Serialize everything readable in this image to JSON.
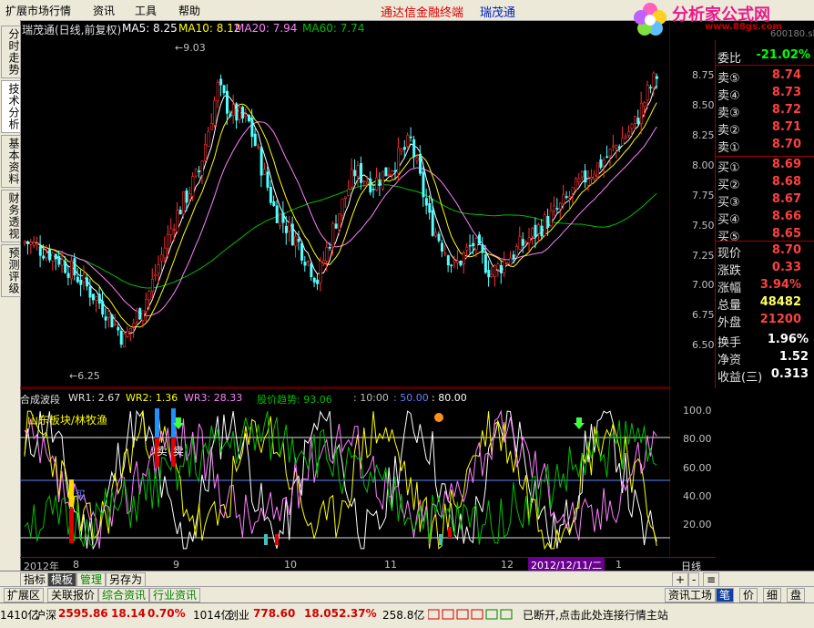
{
  "menu": {
    "items": [
      "扩展市场行情",
      "资讯",
      "工具",
      "帮助"
    ],
    "brand_red": "通达信金融终端",
    "brand_blue": "瑞茂通",
    "logo_title": "分析家公式网",
    "logo_url": "www.88gs.com",
    "logo_code": "600180.sh"
  },
  "left_tabs": [
    "分时走势",
    "技术分析",
    "基本资料",
    "财务透视",
    "预测评级"
  ],
  "main_header": {
    "title": "瑞茂通(日线,前复权)",
    "ma5": "MA5: 8.25",
    "ma10": "MA10: 8.12",
    "ma20": "MA20: 7.94",
    "ma60": "MA60: 7.74",
    "high_label": "9.03",
    "low_label": "6.25"
  },
  "price_axis": [
    "8.75",
    "8.50",
    "8.25",
    "8.00",
    "7.75",
    "7.50",
    "7.25",
    "7.00",
    "6.75",
    "6.50"
  ],
  "sub_header": {
    "name": "合成波段",
    "wr1": "WR1: 2.67",
    "wr2": "WR2: 1.36",
    "wr3": "WR3: 28.33",
    "trend": "股价趋势: 93.06",
    "v1": ": 10:00",
    "v2": ": 50.00",
    "v3": ": 80.00",
    "overlay": "山东板块/林牧渔",
    "buy_label": "买",
    "sell_label1": "卖",
    "sell_label2": "卖"
  },
  "sub_axis": [
    "100.0",
    "80.00",
    "60.00",
    "40.00",
    "20.00"
  ],
  "date_axis": {
    "year": "2012年",
    "months": [
      "8",
      "9",
      "10",
      "11",
      "12",
      "1"
    ],
    "cursor_date": "2012/12/11/二",
    "period": "日线"
  },
  "quote": {
    "ratio_label": "委比",
    "ratio_value": "-21.02%",
    "sells": [
      {
        "label": "卖⑤",
        "price": "8.74"
      },
      {
        "label": "卖④",
        "price": "8.73"
      },
      {
        "label": "卖③",
        "price": "8.72"
      },
      {
        "label": "卖②",
        "price": "8.71"
      },
      {
        "label": "卖①",
        "price": "8.70"
      }
    ],
    "buys": [
      {
        "label": "买①",
        "price": "8.69"
      },
      {
        "label": "买②",
        "price": "8.68"
      },
      {
        "label": "买③",
        "price": "8.67"
      },
      {
        "label": "买④",
        "price": "8.66"
      },
      {
        "label": "买⑤",
        "price": "8.65"
      }
    ],
    "stats": [
      {
        "label": "现价",
        "value": "8.70",
        "color": "#ff4040"
      },
      {
        "label": "涨跌",
        "value": "0.33",
        "color": "#ff4040"
      },
      {
        "label": "涨幅",
        "value": "3.94%",
        "color": "#ff4040"
      },
      {
        "label": "总量",
        "value": "48482",
        "color": "#ffff60"
      },
      {
        "label": "外盘",
        "value": "21200",
        "color": "#ff4040"
      },
      {
        "label": "换手",
        "value": "1.96%",
        "color": "#ffffff"
      },
      {
        "label": "净资",
        "value": "1.52",
        "color": "#ffffff"
      },
      {
        "label": "收益(三)",
        "value": "0.313",
        "color": "#ffffff"
      }
    ]
  },
  "bottom_tabs1": [
    "指标",
    "模板",
    "管理",
    "另存为"
  ],
  "bottom_tabs1_right": [
    "+",
    "-",
    "≡"
  ],
  "bottom_tabs2": [
    "扩展区",
    "关联报价",
    "综合资讯",
    "行业资讯"
  ],
  "bottom_tabs2_right": [
    "资讯工场",
    "笔",
    "价",
    "细",
    "盘"
  ],
  "status": {
    "cut": "1410亿",
    "hs_label": "沪深",
    "hs_value": "2595.86",
    "hs_change": "18.14",
    "hs_pct": "0.70%",
    "hs_vol": "1014亿",
    "cy_label": "创业",
    "cy_value": "778.60",
    "cy_change": "18.05",
    "cy_pct": "2.37%",
    "cy_vol": "258.8亿",
    "message": "已断开,点击此处连接行情主站"
  },
  "colors": {
    "up": "#ff3232",
    "down": "#54ffff",
    "ma5": "#ffffff",
    "ma10": "#ffff00",
    "ma20": "#ff80ff",
    "ma60": "#00c000"
  }
}
